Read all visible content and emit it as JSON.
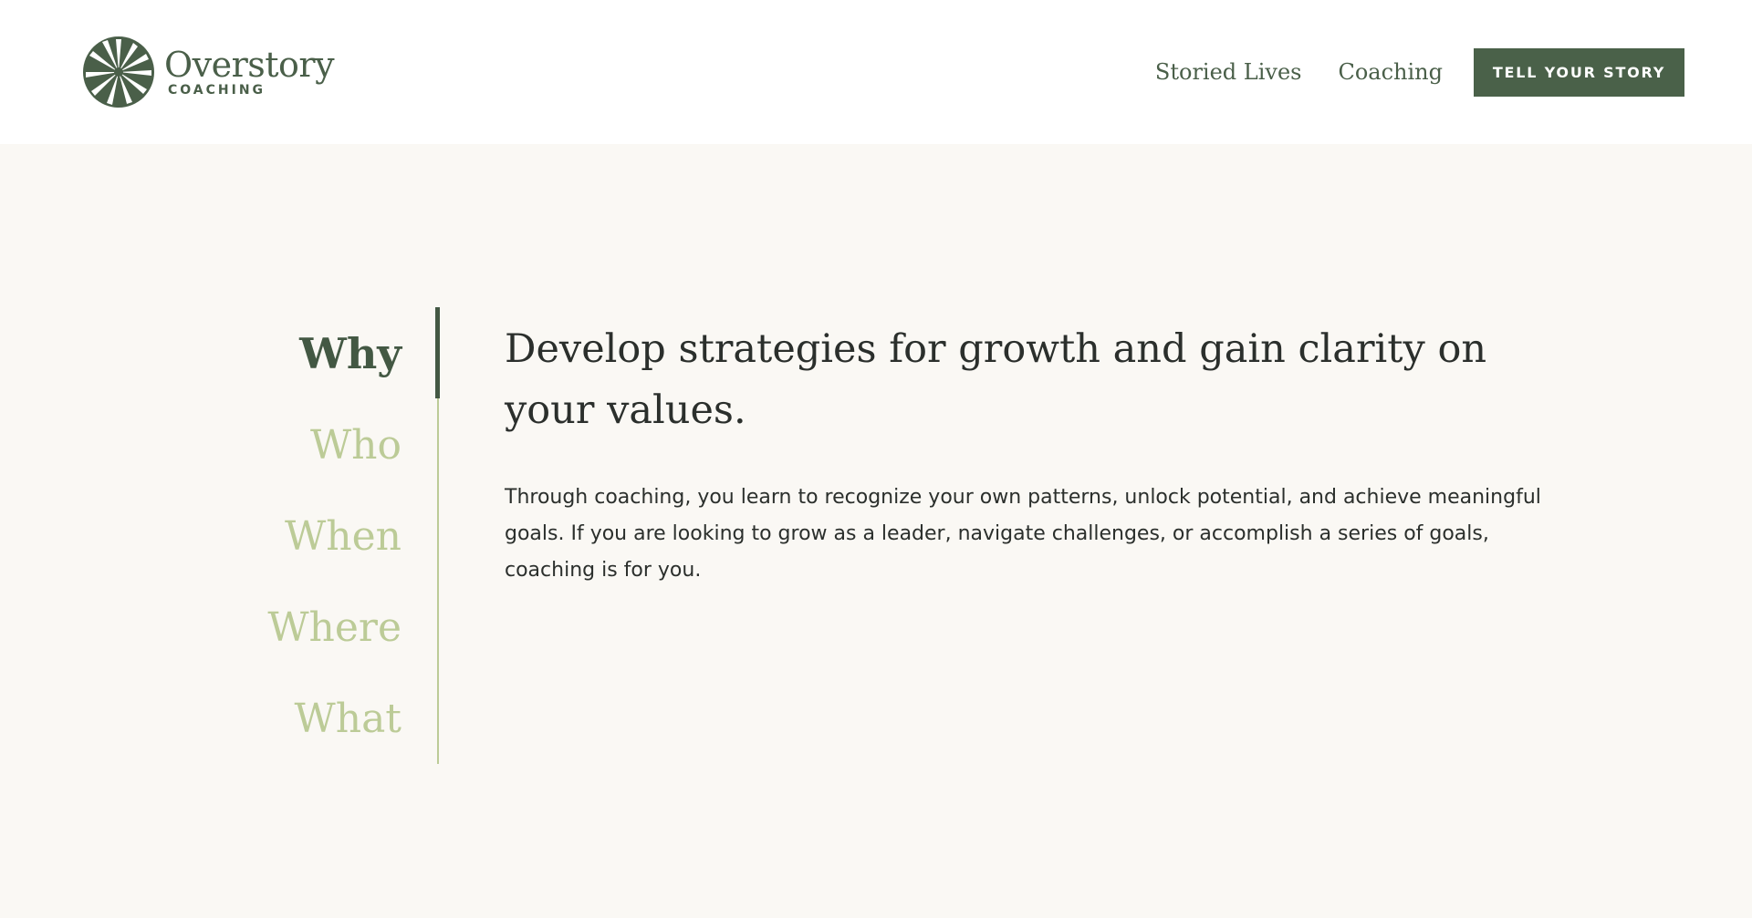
{
  "brand": {
    "name": "Overstory",
    "sub": "COACHING",
    "color": "#4a5f49"
  },
  "nav": {
    "links": [
      "Storied Lives",
      "Coaching"
    ],
    "cta": "TELL YOUR STORY"
  },
  "tabs": {
    "items": [
      "Why",
      "Who",
      "When",
      "Where",
      "What"
    ],
    "active": "Why"
  },
  "panel": {
    "title": "Develop strategies for growth and gain clarity on your values.",
    "body": "Through coaching, you learn to recognize your own patterns, unlock potential, and achieve meaningful goals. If you are looking to grow as a leader, navigate challenges, or accomplish a series of goals, coaching is for you."
  },
  "colors": {
    "header_bg": "#ffffff",
    "content_bg": "#faf8f4",
    "accent_dark": "#435843",
    "accent_light": "#bccb97",
    "button_bg": "#4a6149",
    "text": "#2b2f2c"
  },
  "icons": {
    "logo": "tree-canopy-starburst-icon"
  }
}
